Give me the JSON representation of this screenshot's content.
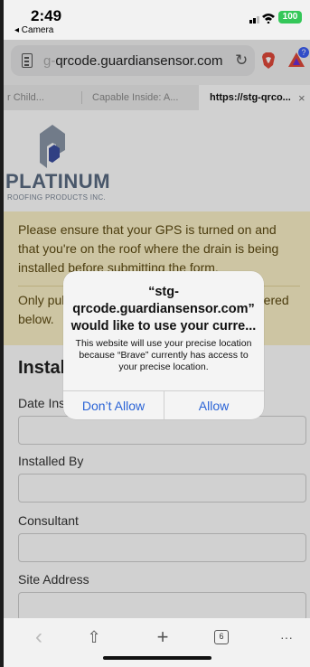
{
  "status": {
    "time": "2:49",
    "back_app": "◂ Camera",
    "battery": "100"
  },
  "urlbar": {
    "url_faded": "g-",
    "url_main": "qrcode.guardiansensor.com",
    "bat_badge": "?"
  },
  "tabs": [
    {
      "label": "r Child..."
    },
    {
      "label": "Capable Inside: A..."
    },
    {
      "label": "https://stg-qrco..."
    }
  ],
  "tab_close": "×",
  "logo": {
    "word": "PLATINUM",
    "sub": "ROOFING PRODUCTS INC."
  },
  "alert": {
    "p1": "Please ensure that your GPS is turned on and that you're on the roof where the drain is being installed before submitting the form.",
    "p2a": "Only pul",
    "p2b": "ntered",
    "p2c": "below."
  },
  "form": {
    "title": "Install",
    "fields": [
      {
        "label": "Date Ins"
      },
      {
        "label": "Installed By"
      },
      {
        "label": "Consultant"
      },
      {
        "label": "Site Address"
      }
    ]
  },
  "dialog": {
    "title": "“stg-qrcode.guardiansensor.com” would like to use your curre...",
    "message": "This website will use your precise location because “Brave” currently has access to your precise location.",
    "deny": "Don’t Allow",
    "allow": "Allow"
  },
  "toolbar": {
    "back": "‹",
    "share": "⇧",
    "new_tab": "+",
    "tab_count": "6",
    "more": "···"
  },
  "colors": {
    "alert_bg": "#fbf1c7",
    "dialog_button": "#2a63d6"
  }
}
